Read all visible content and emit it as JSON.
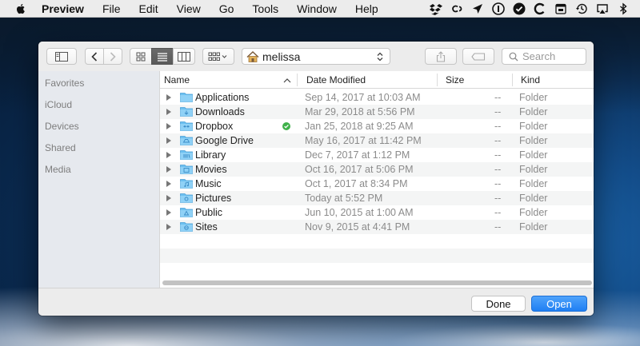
{
  "menubar": {
    "app_name": "Preview",
    "items": [
      "File",
      "Edit",
      "View",
      "Go",
      "Tools",
      "Window",
      "Help"
    ],
    "status_icons": [
      "dropbox-icon",
      "creative-cloud-icon",
      "location-arrow-icon",
      "onepassword-icon",
      "checkmark-circle-icon",
      "ccleaner-icon",
      "calendar-icon",
      "time-machine-icon",
      "airplay-icon",
      "bluetooth-icon"
    ]
  },
  "toolbar": {
    "path_name": "melissa",
    "search_placeholder": "Search"
  },
  "sidebar": {
    "sections": [
      "Favorites",
      "iCloud",
      "Devices",
      "Shared",
      "Media"
    ]
  },
  "columns": {
    "name": "Name",
    "date": "Date Modified",
    "size": "Size",
    "kind": "Kind"
  },
  "files": [
    {
      "name": "Applications",
      "date": "Sep 14, 2017 at 10:03 AM",
      "size": "--",
      "kind": "Folder"
    },
    {
      "name": "Downloads",
      "date": "Mar 29, 2018 at 5:56 PM",
      "size": "--",
      "kind": "Folder"
    },
    {
      "name": "Dropbox",
      "date": "Jan 25, 2018 at 9:25 AM",
      "size": "--",
      "kind": "Folder"
    },
    {
      "name": "Google Drive",
      "date": "May 16, 2017 at 11:42 PM",
      "size": "--",
      "kind": "Folder"
    },
    {
      "name": "Library",
      "date": "Dec 7, 2017 at 1:12 PM",
      "size": "--",
      "kind": "Folder"
    },
    {
      "name": "Movies",
      "date": "Oct 16, 2017 at 5:06 PM",
      "size": "--",
      "kind": "Folder"
    },
    {
      "name": "Music",
      "date": "Oct 1, 2017 at 8:34 PM",
      "size": "--",
      "kind": "Folder"
    },
    {
      "name": "Pictures",
      "date": "Today at 5:52 PM",
      "size": "--",
      "kind": "Folder"
    },
    {
      "name": "Public",
      "date": "Jun 10, 2015 at 1:00 AM",
      "size": "--",
      "kind": "Folder"
    },
    {
      "name": "Sites",
      "date": "Nov 9, 2015 at 4:41 PM",
      "size": "--",
      "kind": "Folder"
    }
  ],
  "buttons": {
    "done": "Done",
    "open": "Open"
  },
  "colors": {
    "accent": "#1f7ff3",
    "folder": "#6cc0f0",
    "synced": "#3fb14a"
  }
}
